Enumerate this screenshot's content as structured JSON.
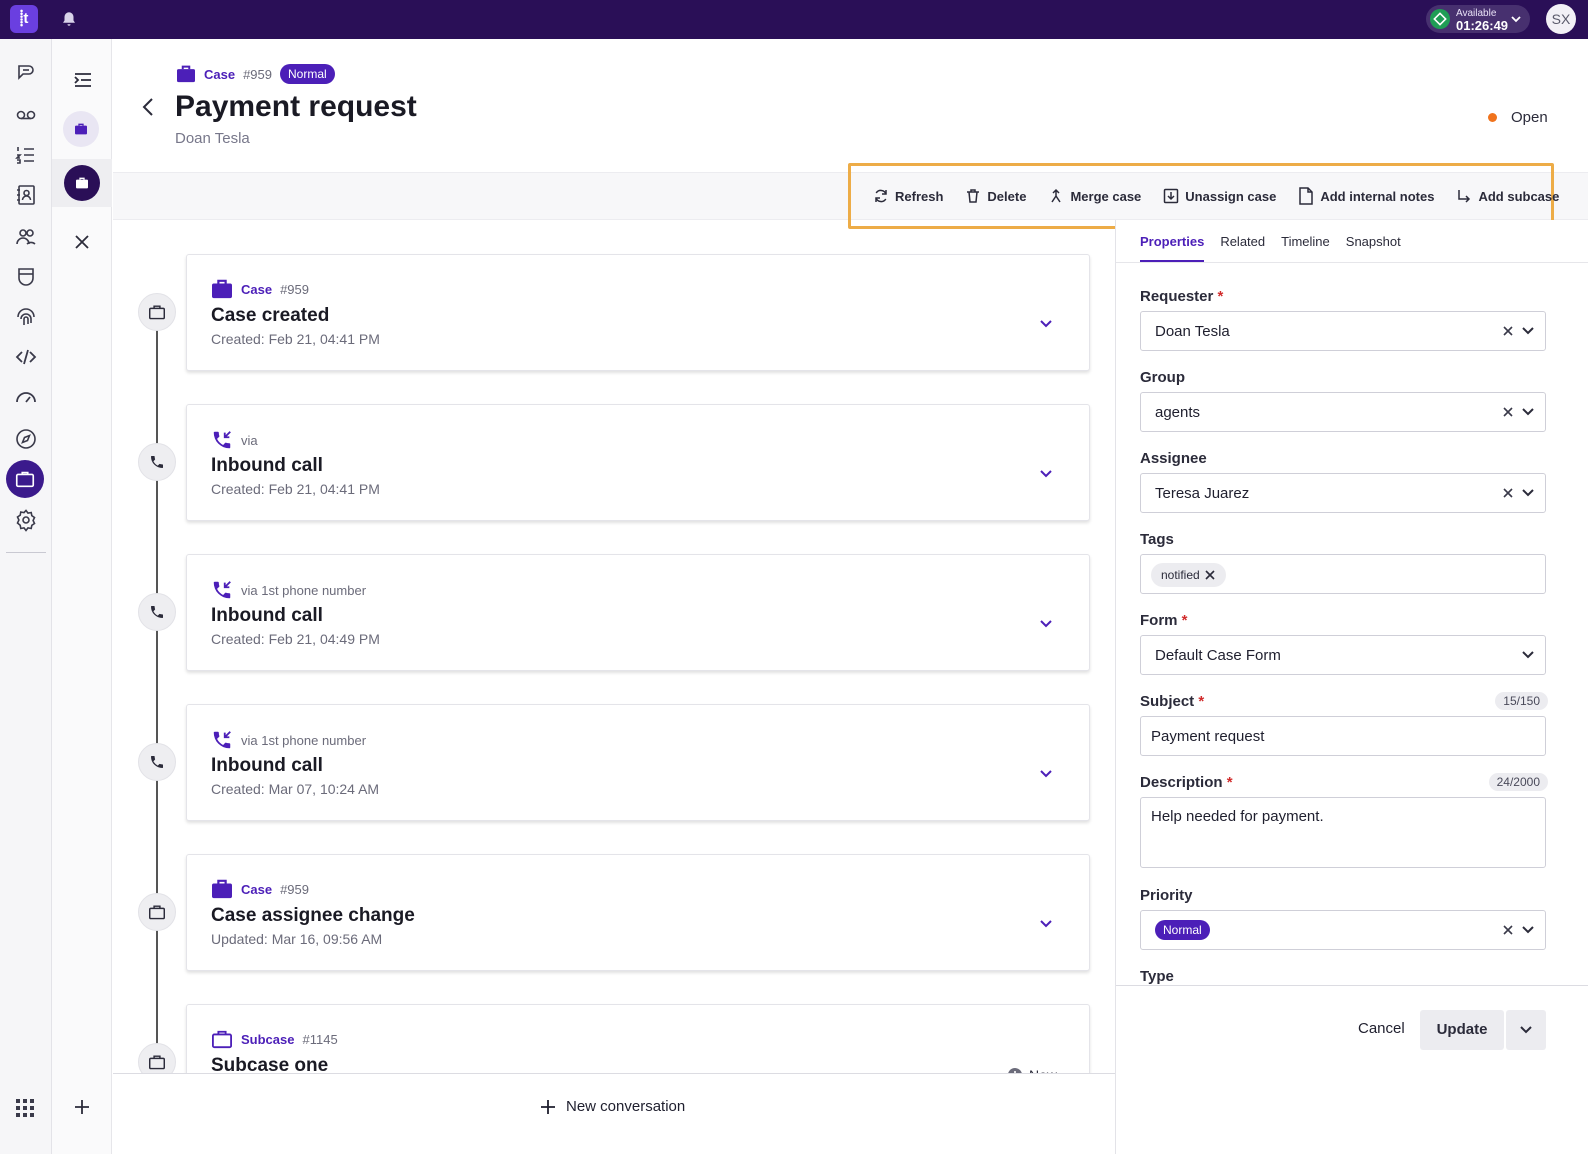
{
  "topbar": {
    "logo_text": "⸽t",
    "status_label": "Available",
    "status_timer": "01:26:49",
    "user_initials": "SX"
  },
  "header": {
    "case_label": "Case",
    "case_number": "#959",
    "priority_badge": "Normal",
    "title": "Payment request",
    "requester_name": "Doan Tesla",
    "status": "Open"
  },
  "toolbar": {
    "refresh": "Refresh",
    "delete": "Delete",
    "merge": "Merge case",
    "unassign": "Unassign case",
    "add_notes": "Add internal notes",
    "add_subcase": "Add subcase"
  },
  "timeline": [
    {
      "type": "Case",
      "via": "#959",
      "title": "Case created",
      "date": "Created: Feb 21, 04:41 PM"
    },
    {
      "type": "",
      "via": "via",
      "title": "Inbound call",
      "date": "Created: Feb 21, 04:41 PM"
    },
    {
      "type": "",
      "via": "via 1st phone number",
      "title": "Inbound call",
      "date": "Created: Feb 21, 04:49 PM"
    },
    {
      "type": "",
      "via": "via 1st phone number",
      "title": "Inbound call",
      "date": "Created: Mar 07, 10:24 AM"
    },
    {
      "type": "Case",
      "via": "#959",
      "title": "Case assignee change",
      "date": "Updated: Mar 16, 09:56 AM"
    },
    {
      "type": "Subcase",
      "via": "#1145",
      "title": "Subcase one",
      "date": "",
      "status": "New"
    }
  ],
  "footer": {
    "new_conversation": "New conversation"
  },
  "panel": {
    "tabs": [
      "Properties",
      "Related",
      "Timeline",
      "Snapshot"
    ],
    "requester_label": "Requester",
    "requester_value": "Doan Tesla",
    "group_label": "Group",
    "group_value": "agents",
    "assignee_label": "Assignee",
    "assignee_value": "Teresa Juarez",
    "tags_label": "Tags",
    "tag_value": "notified",
    "form_label": "Form",
    "form_value": "Default Case Form",
    "subject_label": "Subject",
    "subject_count": "15/150",
    "subject_value": "Payment request",
    "description_label": "Description",
    "description_count": "24/2000",
    "description_value": "Help needed for payment.",
    "priority_label": "Priority",
    "priority_value": "Normal",
    "type_label": "Type",
    "required_mark": "*",
    "cancel": "Cancel",
    "update": "Update"
  },
  "colors": {
    "topbar": "#2a0f57",
    "accent": "#4c1fb8",
    "toolbar_highlight": "#edac47",
    "status_open": "#f0731d"
  }
}
